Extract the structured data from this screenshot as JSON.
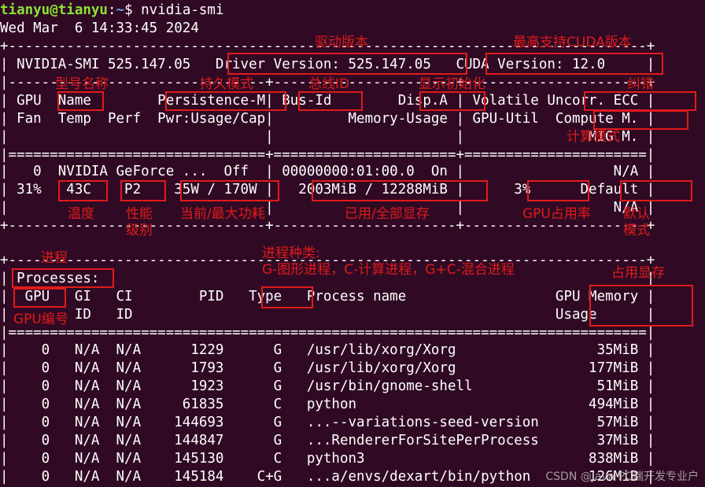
{
  "prompt": {
    "user_host": "tianyu@tianyu",
    "sep": ":",
    "path": "~",
    "symbol": "$ ",
    "command": "nvidia-smi"
  },
  "output_lines": [
    "Wed Mar  6 14:33:45 2024",
    "+-----------------------------------------------------------------------------+",
    "| NVIDIA-SMI 525.147.05   Driver Version: 525.147.05   CUDA Version: 12.0     |",
    "|-------------------------------+----------------------+----------------------+",
    "| GPU  Name        Persistence-M| Bus-Id        Disp.A | Volatile Uncorr. ECC |",
    "| Fan  Temp  Perf  Pwr:Usage/Cap|         Memory-Usage | GPU-Util  Compute M. |",
    "|                               |                      |               MIG M. |",
    "|===============================+======================+======================|",
    "|   0  NVIDIA GeForce ...  Off  | 00000000:01:00.0  On |                  N/A |",
    "| 31%   43C    P2    35W / 170W |   2003MiB / 12288MiB |      3%      Default |",
    "|                               |                      |                  N/A |",
    "+-------------------------------+----------------------+----------------------+",
    "",
    "+-----------------------------------------------------------------------------+",
    "| Processes:                                                                  |",
    "|  GPU   GI   CI        PID   Type   Process name                  GPU Memory |",
    "|        ID   ID                                                   Usage      |",
    "|=============================================================================|",
    "|    0   N/A  N/A      1229      G   /usr/lib/xorg/Xorg                 35MiB |",
    "|    0   N/A  N/A      1793      G   /usr/lib/xorg/Xorg                177MiB |",
    "|    0   N/A  N/A      1923      G   /usr/bin/gnome-shell               51MiB |",
    "|    0   N/A  N/A     61835      C   python                            494MiB |",
    "|    0   N/A  N/A    144693      G   ...--variations-seed-version       57MiB |",
    "|    0   N/A  N/A    144847      G   ...RendererForSitePerProcess       37MiB |",
    "|    0   N/A  N/A    145130      C   python3                           838MiB |",
    "|    0   N/A  N/A    145184    C+G   ...a/envs/dexart/bin/python       126MiB |"
  ],
  "annotations": {
    "driver_version": "驱动版本",
    "cuda_version": "最高支持CUDA版本",
    "name": "型号名称",
    "persistence": "持久模式",
    "bus_id": "总线ID",
    "disp": "显示初始化",
    "ecc": "纠错",
    "compute_mode": "计算模式",
    "temp": "温度",
    "perf": "性能\n级别",
    "power": "当前/最大功耗",
    "memory_usage": "已用/全部显存",
    "gpu_util": "GPU占用率",
    "default_mode": "默认\n模式",
    "processes": "进程",
    "type": "进程种类:\nG-图形进程，C-计算进程，G+C-混合进程",
    "gpu_memory": "占用显存",
    "gpu_index": "GPU编号"
  },
  "watermark": "CSDN @Java PC端开发专业户",
  "colors": {
    "background": "#300a24",
    "text": "#ffffff",
    "prompt_user": "#8ae234",
    "prompt_path": "#729fcf",
    "annotation_red": "#e01b1b"
  }
}
